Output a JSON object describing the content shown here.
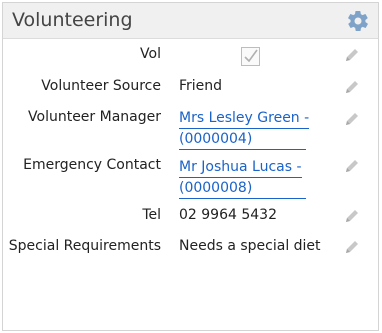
{
  "panel": {
    "title": "Volunteering",
    "gear_icon": "gear-icon",
    "accent_color": "#7fa3c8",
    "link_color": "#1a63c9"
  },
  "fields": {
    "vol": {
      "label": "Vol",
      "checked": true
    },
    "source": {
      "label": "Volunteer Source",
      "value": "Friend"
    },
    "manager": {
      "label": "Volunteer Manager",
      "value_line1": "Mrs Lesley Green -",
      "value_line2": "(0000004)"
    },
    "emergency": {
      "label": "Emergency Contact",
      "value_line1": "Mr Joshua Lucas -",
      "value_line2": "(0000008)"
    },
    "tel": {
      "label": "Tel",
      "value": "02 9964 5432"
    },
    "special": {
      "label": "Special Requirements",
      "value": "Needs a special diet"
    }
  },
  "edit_icon": "pencil-icon"
}
